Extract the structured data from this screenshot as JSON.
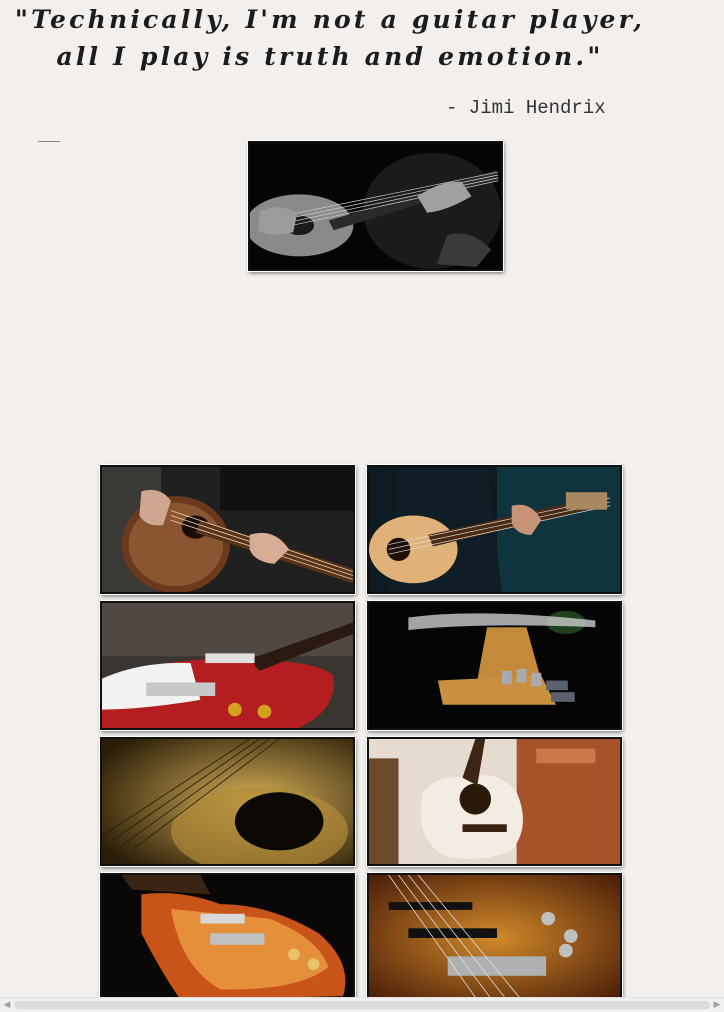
{
  "quote": {
    "line1": "\"Technically, I'm not a guitar player,",
    "line2": "all I play is truth and emotion.\"",
    "author": "- Jimi Hendrix"
  },
  "images": {
    "hero": "guitarist-black-and-white",
    "gallery": [
      "acoustic-guitar-player",
      "acoustic-guitar-blue-jacket",
      "red-electric-guitar",
      "guitar-headstock-dark",
      "acoustic-strings-closeup",
      "white-acoustic-guitar-chair",
      "sunburst-les-paul",
      "bass-guitar-bridge"
    ]
  },
  "scrollbar": {
    "left_icon": "arrow-left-icon",
    "right_icon": "arrow-right-icon"
  }
}
